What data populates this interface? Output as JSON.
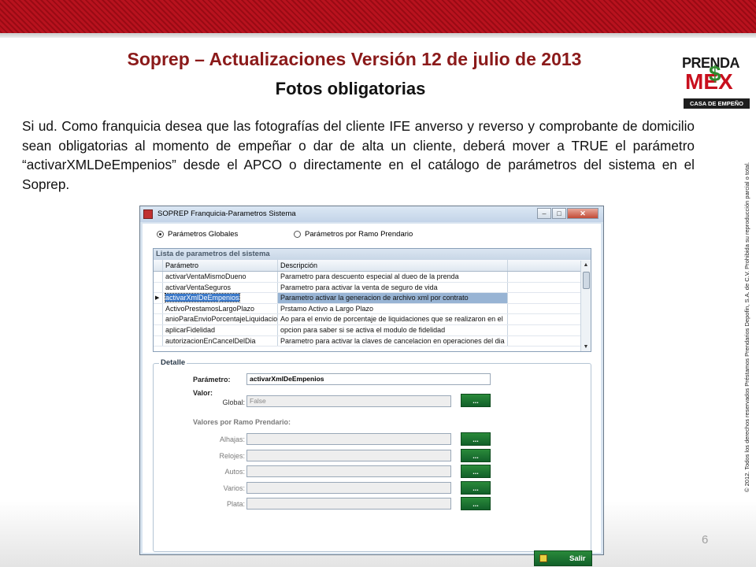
{
  "slide": {
    "title": "Soprep – Actualizaciones Versión 12 de julio de 2013",
    "subtitle": "Fotos obligatorias",
    "body": "Si ud. Como franquicia desea que las fotografías del cliente IFE anverso y reverso y comprobante de domicilio sean obligatorias al momento de empeñar o dar de alta un cliente, deberá mover a TRUE el parámetro “activarXMLDeEmpenios” desde el APCO o directamente en el catálogo de parámetros del sistema en el Soprep.",
    "page_number": "6",
    "copyright": "© 2012. Todos los derechos reservados Préstamos Prendarios Depofin, S.A. de C.V. Prohibida su reproducción parcial o total.",
    "logo": {
      "line1": "PRENDA",
      "line2": "MEX",
      "dollar": "$",
      "tagline": "CASA DE EMPEÑO",
      "registered": "®"
    }
  },
  "window": {
    "title": "SOPREP Franquicia-Parametros Sistema",
    "controls": {
      "minimize": "–",
      "maximize": "□",
      "close": "✕"
    },
    "radios": [
      {
        "label": "Parámetros Globales",
        "checked": true
      },
      {
        "label": "Parámetros por Ramo Prendario",
        "checked": false
      }
    ],
    "grid": {
      "caption": "Lista de parametros del sistema",
      "headers": [
        "Parámetro",
        "Descripción"
      ],
      "rows": [
        {
          "param": "activarVentaMismoDueno",
          "desc": "Parametro para descuento especial al dueo de la prenda",
          "selected": false
        },
        {
          "param": "activarVentaSeguros",
          "desc": "Parametro para activar la venta de seguro de vida",
          "selected": false
        },
        {
          "param": "activarXmlDeEmpenios",
          "desc": "Parametro activar la generacion de archivo xml por contrato",
          "selected": true
        },
        {
          "param": "ActivoPrestamosLargoPlazo",
          "desc": "Prstamo Activo a Largo Plazo",
          "selected": false
        },
        {
          "param": "anioParaEnvioPorcentajeLiquidacio",
          "desc": "Ao para el envio de porcentaje de liquidaciones que se realizaron en el",
          "selected": false
        },
        {
          "param": "aplicarFidelidad",
          "desc": "opcion para saber si se activa el modulo de fidelidad",
          "selected": false
        },
        {
          "param": "autorizacionEnCancelDelDia",
          "desc": "Parametro para activar la claves de cancelacion en operaciones del dia",
          "selected": false
        }
      ]
    },
    "detalle": {
      "label": "Detalle",
      "parametro_label": "Parámetro:",
      "parametro_value": "activarXmlDeEmpenios",
      "valor_label": "Valor:",
      "global_label": "Global:",
      "global_value": "False",
      "ramo_label": "Valores por Ramo Prendario:",
      "ramos": [
        "Alhajas:",
        "Relojes:",
        "Autos:",
        "Varios:",
        "Plata:"
      ],
      "button_label": "..."
    },
    "salir_label": "Salir"
  }
}
